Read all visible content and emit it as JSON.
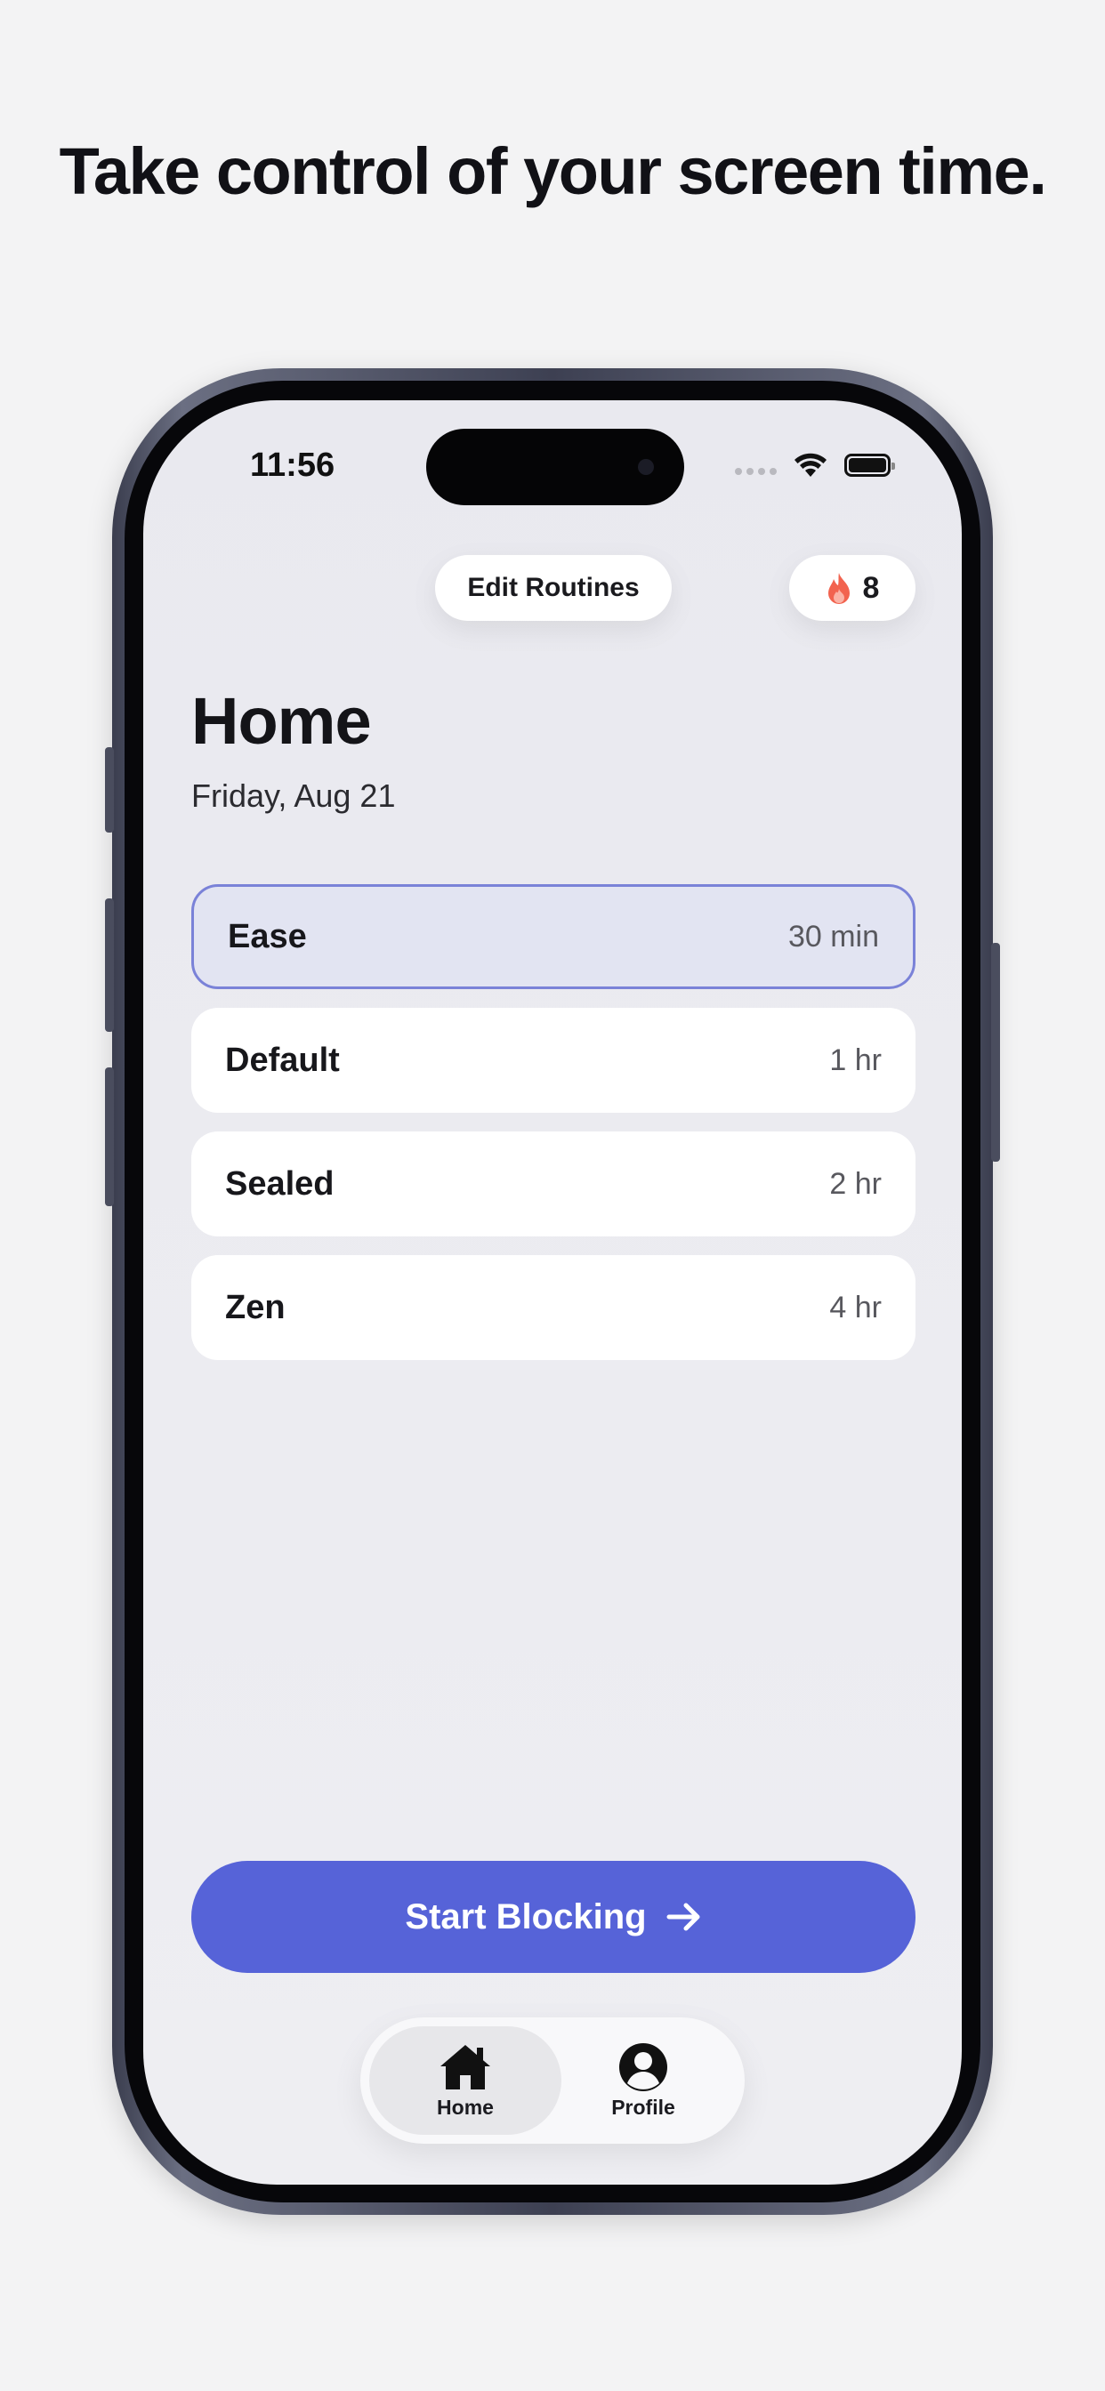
{
  "headline": "Take control of your screen time.",
  "status_bar": {
    "time": "11:56"
  },
  "top_actions": {
    "edit_routines_label": "Edit Routines",
    "streak_count": "8"
  },
  "page": {
    "title": "Home",
    "date": "Friday, Aug 21"
  },
  "routines": [
    {
      "name": "Ease",
      "duration": "30 min",
      "selected": true
    },
    {
      "name": "Default",
      "duration": "1 hr",
      "selected": false
    },
    {
      "name": "Sealed",
      "duration": "2 hr",
      "selected": false
    },
    {
      "name": "Zen",
      "duration": "4 hr",
      "selected": false
    }
  ],
  "cta": {
    "label": "Start Blocking"
  },
  "tabs": [
    {
      "label": "Home",
      "icon": "house-icon",
      "active": true
    },
    {
      "label": "Profile",
      "icon": "person-circle-icon",
      "active": false
    }
  ],
  "colors": {
    "accent": "#5663d8",
    "selected_border": "#7a82d8",
    "selected_bg": "#e2e4f2",
    "flame": "#f2634f"
  }
}
